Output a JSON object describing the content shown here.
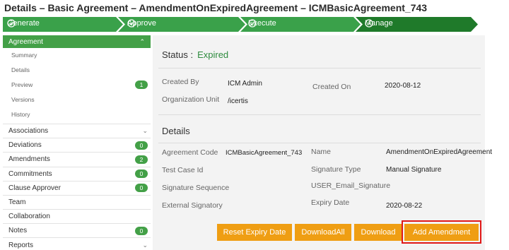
{
  "page": {
    "title": "Details – Basic Agreement – AmendmentOnExpiredAgreement – ICMBasicAgreement_743"
  },
  "workflow": {
    "steps": [
      {
        "label": "Generate",
        "icon": "check-circle-icon"
      },
      {
        "label": "Approve",
        "icon": "check-circle-icon"
      },
      {
        "label": "Execute",
        "icon": "check-circle-icon"
      },
      {
        "label": "Manage",
        "icon": "clock-icon"
      }
    ],
    "completed_color": "#3aa14a",
    "active_color": "#1f7a2a"
  },
  "sidebar": {
    "active_section": "Agreement",
    "sub_items": [
      {
        "label": "Summary",
        "badge": ""
      },
      {
        "label": "Details",
        "badge": ""
      },
      {
        "label": "Preview",
        "badge": "1"
      },
      {
        "label": "Versions",
        "badge": ""
      },
      {
        "label": "History",
        "badge": ""
      }
    ],
    "items": [
      {
        "label": "Associations",
        "badge": "",
        "chevron": true
      },
      {
        "label": "Deviations",
        "badge": "0",
        "chevron": false
      },
      {
        "label": "Amendments",
        "badge": "2",
        "chevron": false
      },
      {
        "label": "Commitments",
        "badge": "0",
        "chevron": false
      },
      {
        "label": "Clause Approver",
        "badge": "0",
        "chevron": false
      },
      {
        "label": "Team",
        "badge": "",
        "chevron": false
      },
      {
        "label": "Collaboration",
        "badge": "",
        "chevron": false
      },
      {
        "label": "Notes",
        "badge": "0",
        "chevron": false
      },
      {
        "label": "Reports",
        "badge": "",
        "chevron": true
      }
    ]
  },
  "status": {
    "label": "Status :",
    "value": "Expired"
  },
  "info": {
    "created_by_label": "Created By",
    "created_by_value": "ICM Admin",
    "created_on_label": "Created On",
    "created_on_value": "2020-08-12",
    "org_unit_label": "Organization Unit",
    "org_unit_value": "/icertis"
  },
  "details": {
    "title": "Details",
    "agreement_code_label": "Agreement Code",
    "agreement_code_value": "ICMBasicAgreement_743",
    "name_label": "Name",
    "name_value": "AmendmentOnExpiredAgreement",
    "test_case_label": "Test Case Id",
    "signature_type_label": "Signature Type",
    "signature_type_value": "Manual Signature",
    "signature_sequence_label": "Signature Sequence",
    "user_email_signature_label": "USER_Email_Signature",
    "external_signatory_label": "External Signatory",
    "expiry_date_label": "Expiry Date",
    "expiry_date_value": "2020-08-22"
  },
  "actions": {
    "reset_expiry_date": "Reset Expiry Date",
    "download_all": "DownloadAll",
    "download": "Download",
    "add_amendment": "Add Amendment"
  },
  "colors": {
    "accent_green": "#43a047",
    "button_orange": "#ef9e13",
    "highlight_red": "#e01818"
  }
}
